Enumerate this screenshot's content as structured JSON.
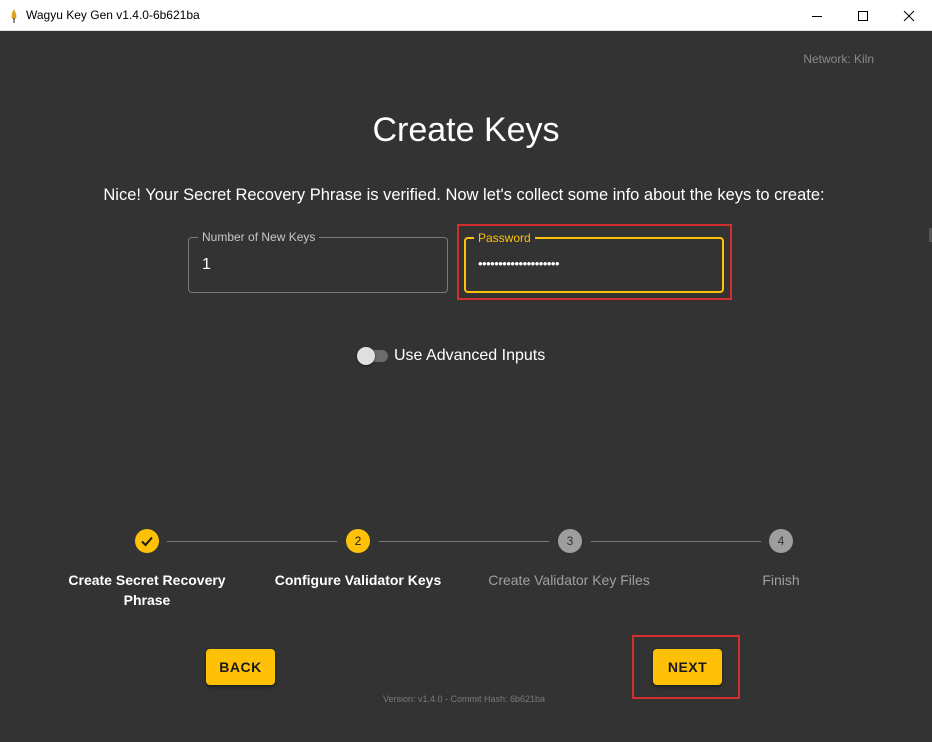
{
  "window": {
    "title": "Wagyu Key Gen v1.4.0-6b621ba",
    "minimize_icon": "minimize-icon",
    "maximize_icon": "maximize-icon",
    "close_icon": "close-icon"
  },
  "network_label": "Network: Kiln",
  "page_title": "Create Keys",
  "subtitle": "Nice! Your Secret Recovery Phrase is verified. Now let's collect some info about the keys to create:",
  "form": {
    "num_keys": {
      "label": "Number of New Keys",
      "value": "1"
    },
    "password": {
      "label": "Password",
      "value": "••••••••••••••••••••"
    }
  },
  "advanced_toggle": {
    "label": "Use Advanced Inputs",
    "checked": false
  },
  "stepper": {
    "steps": [
      {
        "index": "1",
        "label": "Create Secret Recovery Phrase",
        "state": "completed"
      },
      {
        "index": "2",
        "label": "Configure Validator Keys",
        "state": "active"
      },
      {
        "index": "3",
        "label": "Create Validator Key Files",
        "state": "pending"
      },
      {
        "index": "4",
        "label": "Finish",
        "state": "pending"
      }
    ]
  },
  "buttons": {
    "back": "BACK",
    "next": "NEXT"
  },
  "version_text": "Version: v1.4.0 - Commit Hash: 6b621ba",
  "colors": {
    "accent": "#ffc107",
    "background": "#333333",
    "highlight": "#d32f2f"
  }
}
